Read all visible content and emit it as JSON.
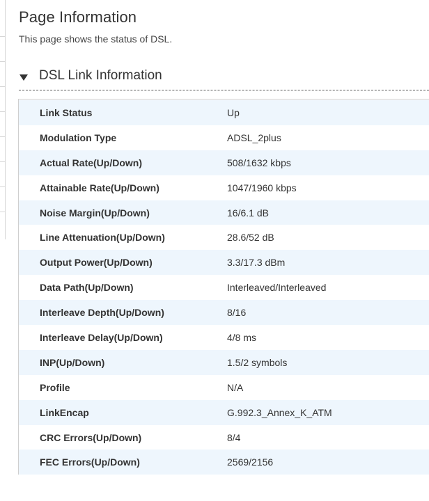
{
  "page": {
    "title": "Page Information",
    "description": "This page shows the status of DSL."
  },
  "section": {
    "title": "DSL Link Information",
    "expanded": true,
    "caret_icon": "triangle-down-icon"
  },
  "rows": [
    {
      "label": "Link Status",
      "value": "Up"
    },
    {
      "label": "Modulation Type",
      "value": "ADSL_2plus"
    },
    {
      "label": "Actual Rate(Up/Down)",
      "value": "508/1632 kbps"
    },
    {
      "label": "Attainable Rate(Up/Down)",
      "value": "1047/1960 kbps"
    },
    {
      "label": "Noise Margin(Up/Down)",
      "value": "16/6.1 dB"
    },
    {
      "label": "Line Attenuation(Up/Down)",
      "value": "28.6/52 dB"
    },
    {
      "label": "Output Power(Up/Down)",
      "value": "3.3/17.3 dBm"
    },
    {
      "label": "Data Path(Up/Down)",
      "value": "Interleaved/Interleaved"
    },
    {
      "label": "Interleave Depth(Up/Down)",
      "value": "8/16"
    },
    {
      "label": "Interleave Delay(Up/Down)",
      "value": "4/8 ms"
    },
    {
      "label": "INP(Up/Down)",
      "value": "1.5/2 symbols"
    },
    {
      "label": "Profile",
      "value": "N/A"
    },
    {
      "label": "LinkEncap",
      "value": "G.992.3_Annex_K_ATM"
    },
    {
      "label": "CRC Errors(Up/Down)",
      "value": "8/4"
    },
    {
      "label": "FEC Errors(Up/Down)",
      "value": "2569/2156"
    }
  ],
  "colors": {
    "row_stripe": "#eef6fd",
    "text": "#333333",
    "border": "#cfcfcf"
  }
}
